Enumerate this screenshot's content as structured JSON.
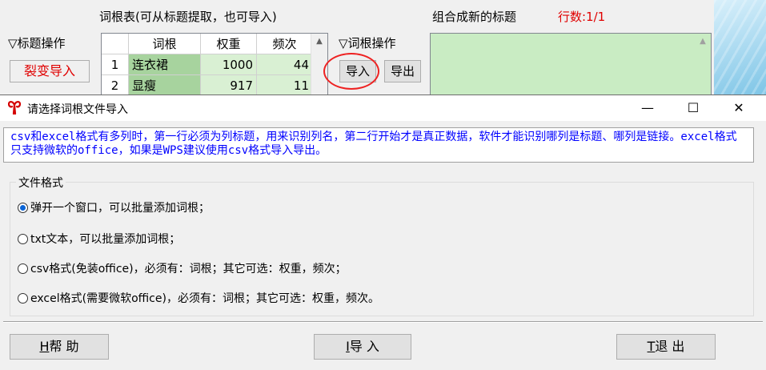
{
  "app": {
    "word_table_title": "词根表(可从标题提取，也可导入)",
    "new_titles_label": "组合成新的标题",
    "row_count": "行数:1/1",
    "title_ops_label": "▽标题操作",
    "split_import_button": "裂变导入",
    "word_ops_label": "▽词根操作",
    "import_button": "导入",
    "export_button": "导出",
    "table": {
      "headers": [
        "",
        "词根",
        "权重",
        "频次"
      ],
      "rows": [
        {
          "n": "1",
          "word": "连衣裙",
          "weight": "1000",
          "freq": "44"
        },
        {
          "n": "2",
          "word": "显瘦",
          "weight": "917",
          "freq": "11"
        }
      ]
    }
  },
  "dialog": {
    "title": "请选择词根文件导入",
    "controls": {
      "minimize": "—",
      "maximize": "☐",
      "close": "✕"
    },
    "notice": "csv和excel格式有多列时，第一行必须为列标题，用来识别列名，第二行开始才是真正数据，软件才能识别哪列是标题、哪列是链接。excel格式只支持微软的office，如果是WPS建议使用csv格式导入导出。",
    "group_label": "文件格式",
    "options": [
      {
        "label": "弹开一个窗口，可以批量添加词根；",
        "checked": true
      },
      {
        "label": "txt文本，可以批量添加词根；",
        "checked": false
      },
      {
        "label": "csv格式(免装office)，必须有：词根；其它可选：权重，频次；",
        "checked": false
      },
      {
        "label": "excel格式(需要微软office)，必须有：词根；其它可选：权重，频次。",
        "checked": false
      }
    ],
    "buttons": {
      "help_key": "H",
      "help": "帮 助",
      "import_key": "I",
      "import": "导 入",
      "exit_key": "T",
      "exit": "退 出"
    }
  },
  "colors": {
    "accent_red": "#e00000",
    "notice_blue": "#0000ff",
    "green_cell": "#a7d39e",
    "green_panel": "#c9ecc3"
  }
}
